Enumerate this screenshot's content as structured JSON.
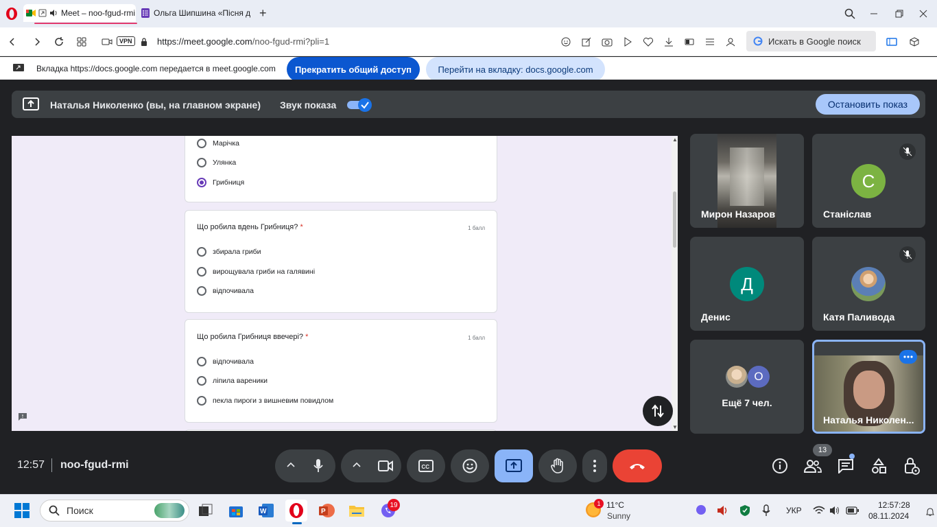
{
  "browser": {
    "tabs": [
      {
        "title": "Meet – noo-fgud-rmi"
      },
      {
        "title": "Ольга Шипшина «Пісня д"
      }
    ],
    "vpn_label": "VPN",
    "url_host": "https://meet.google.com",
    "url_path": "/noo-fgud-rmi?pli=1",
    "search_label": "Искать в Google поиск"
  },
  "share_notice": {
    "text": "Вкладка https://docs.google.com передается в meet.google.com",
    "stop_label": "Прекратить общий доступ",
    "goto_label": "Перейти на вкладку: docs.google.com"
  },
  "presenting_bar": {
    "title": "Наталья Николенко (вы, на главном экране)",
    "audio_label": "Звук показа",
    "audio_on": true,
    "stop_label": "Остановить показ"
  },
  "form": {
    "card1": {
      "options": [
        "Марічка",
        "Улянка",
        "Грибниця"
      ],
      "selected": 2
    },
    "card2": {
      "question": "Що робила вдень Грибниця?",
      "required_mark": "*",
      "points": "1 балл",
      "options": [
        "збирала гриби",
        "вирощувала гриби на галявині",
        "відпочивала"
      ]
    },
    "card3": {
      "question": "Що робила Грибниця ввечері?",
      "required_mark": "*",
      "points": "1 балл",
      "options": [
        "відпочивала",
        "ліпила вареники",
        "пекла пироги з вишневим повидлом"
      ]
    }
  },
  "participants": [
    {
      "name": "Мирон Назаров",
      "type": "video"
    },
    {
      "name": "Станіслав",
      "initial": "С",
      "color": "#7cb342",
      "muted": true
    },
    {
      "name": "Денис",
      "initial": "Д",
      "color": "#00897b"
    },
    {
      "name": "Катя Паливода",
      "type": "photo",
      "muted": true
    },
    {
      "name": "Ещё 7 чел.",
      "initial": "О",
      "color": "#5c6bc0"
    },
    {
      "name": "Наталья Николен...",
      "type": "video",
      "self": true
    }
  ],
  "meeting": {
    "time": "12:57",
    "code": "noo-fgud-rmi",
    "people_count": "13"
  },
  "taskbar": {
    "search_label": "Поиск",
    "viber_badge": "19",
    "weather_badge": "1",
    "temperature": "11°C",
    "condition": "Sunny",
    "language": "УКР",
    "clock_time": "12:57:28",
    "clock_date": "08.11.2024"
  },
  "colors": {
    "accent_blue": "#0b57d0",
    "end_call": "#ea4335",
    "form_purple": "#673ab7"
  }
}
